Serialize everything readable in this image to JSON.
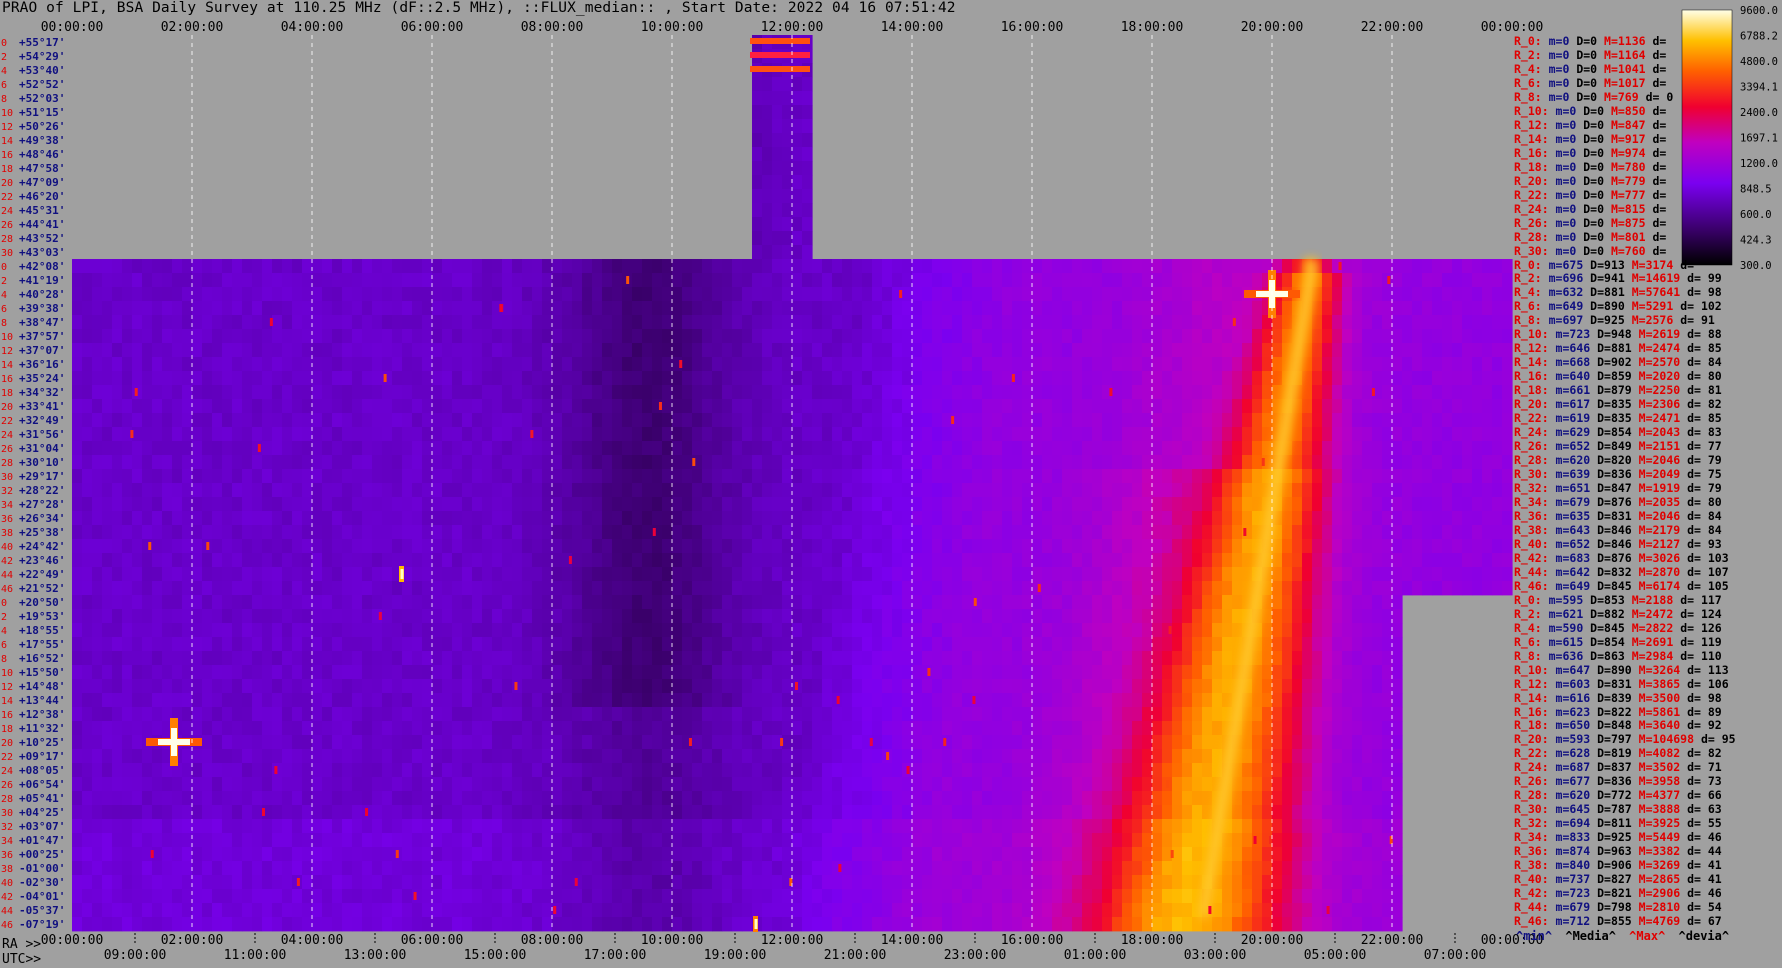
{
  "title": "PRAO of LPI, BSA Daily Survey at 110.25 MHz (dF::2.5 MHz), ::FLUX_median:: , Start Date: 2022 04 16 07:51:42",
  "top_time_labels": [
    "00:00:00",
    "02:00:00",
    "04:00:00",
    "06:00:00",
    "08:00:00",
    "10:00:00",
    "12:00:00",
    "14:00:00",
    "16:00:00",
    "18:00:00",
    "20:00:00",
    "22:00:00",
    "00:00:00"
  ],
  "ra_prefix": "RA >>",
  "ra_labels": [
    "00:00:00",
    "02:00:00",
    "04:00:00",
    "06:00:00",
    "08:00:00",
    "10:00:00",
    "12:00:00",
    "14:00:00",
    "16:00:00",
    "18:00:00",
    "20:00:00",
    "22:00:00",
    "00:00:00"
  ],
  "utc_prefix": "UTC>>",
  "utc_labels": [
    "09:00:00",
    "11:00:00",
    "13:00:00",
    "15:00:00",
    "17:00:00",
    "19:00:00",
    "21:00:00",
    "23:00:00",
    "01:00:00",
    "03:00:00",
    "05:00:00",
    "07:00:00"
  ],
  "colorbar_labels": [
    "9600.0",
    "6788.2",
    "4800.0",
    "3394.1",
    "2400.0",
    "1697.1",
    "1200.0",
    "848.5",
    "600.0",
    "424.3",
    "300.0"
  ],
  "declinations": [
    "+55°17'",
    "+54°29'",
    "+53°40'",
    "+52°52'",
    "+52°03'",
    "+51°15'",
    "+50°26'",
    "+49°38'",
    "+48°46'",
    "+47°58'",
    "+47°09'",
    "+46°20'",
    "+45°31'",
    "+44°41'",
    "+43°52'",
    "+43°03'",
    "+42°08'",
    "+41°19'",
    "+40°28'",
    "+39°38'",
    "+38°47'",
    "+37°57'",
    "+37°07'",
    "+36°16'",
    "+35°24'",
    "+34°32'",
    "+33°41'",
    "+32°49'",
    "+31°56'",
    "+31°04'",
    "+30°10'",
    "+29°17'",
    "+28°22'",
    "+27°28'",
    "+26°34'",
    "+25°38'",
    "+24°42'",
    "+23°46'",
    "+22°49'",
    "+21°52'",
    "+20°50'",
    "+19°53'",
    "+18°55'",
    "+17°55'",
    "+16°52'",
    "+15°50'",
    "+14°48'",
    "+13°44'",
    "+12°38'",
    "+11°32'",
    "+10°25'",
    "+09°17'",
    "+08°05'",
    "+06°54'",
    "+05°41'",
    "+04°25'",
    "+03°07'",
    "+01°47'",
    "+00°25'",
    "-01°00'",
    "-02°30'",
    "-04°01'",
    "-05°37'",
    "-07°19'"
  ],
  "row_index_labels": [
    "0",
    "2",
    "4",
    "6",
    "8",
    "10",
    "12",
    "14",
    "16",
    "18",
    "20",
    "22",
    "24",
    "26",
    "28",
    "30",
    "0",
    "2",
    "4",
    "6",
    "8",
    "10",
    "12",
    "14",
    "16",
    "18",
    "20",
    "22",
    "24",
    "26",
    "28",
    "30",
    "32",
    "34",
    "36",
    "38",
    "40",
    "42",
    "44",
    "46",
    "0",
    "2",
    "4",
    "6",
    "8",
    "10",
    "12",
    "14",
    "16",
    "18",
    "20",
    "22",
    "24",
    "26",
    "28",
    "30",
    "32",
    "34",
    "36",
    "38",
    "40",
    "42",
    "44",
    "46"
  ],
  "stats": [
    {
      "k": "R_0:",
      "m": "m=0",
      "d": "D=0",
      "mx": "M=1136",
      "dv": "d="
    },
    {
      "k": "R_2:",
      "m": "m=0",
      "d": "D=0",
      "mx": "M=1164",
      "dv": "d="
    },
    {
      "k": "R_4:",
      "m": "m=0",
      "d": "D=0",
      "mx": "M=1041",
      "dv": "d="
    },
    {
      "k": "R_6:",
      "m": "m=0",
      "d": "D=0",
      "mx": "M=1017",
      "dv": "d="
    },
    {
      "k": "R_8:",
      "m": "m=0",
      "d": "D=0",
      "mx": "M=769",
      "dv": "d= 0"
    },
    {
      "k": "R_10:",
      "m": "m=0",
      "d": "D=0",
      "mx": "M=850",
      "dv": "d="
    },
    {
      "k": "R_12:",
      "m": "m=0",
      "d": "D=0",
      "mx": "M=847",
      "dv": "d="
    },
    {
      "k": "R_14:",
      "m": "m=0",
      "d": "D=0",
      "mx": "M=917",
      "dv": "d="
    },
    {
      "k": "R_16:",
      "m": "m=0",
      "d": "D=0",
      "mx": "M=974",
      "dv": "d="
    },
    {
      "k": "R_18:",
      "m": "m=0",
      "d": "D=0",
      "mx": "M=780",
      "dv": "d="
    },
    {
      "k": "R_20:",
      "m": "m=0",
      "d": "D=0",
      "mx": "M=779",
      "dv": "d="
    },
    {
      "k": "R_22:",
      "m": "m=0",
      "d": "D=0",
      "mx": "M=777",
      "dv": "d="
    },
    {
      "k": "R_24:",
      "m": "m=0",
      "d": "D=0",
      "mx": "M=815",
      "dv": "d="
    },
    {
      "k": "R_26:",
      "m": "m=0",
      "d": "D=0",
      "mx": "M=875",
      "dv": "d="
    },
    {
      "k": "R_28:",
      "m": "m=0",
      "d": "D=0",
      "mx": "M=801",
      "dv": "d="
    },
    {
      "k": "R_30:",
      "m": "m=0",
      "d": "D=0",
      "mx": "M=760",
      "dv": "d="
    },
    {
      "k": "R_0:",
      "m": "m=675",
      "d": "D=913",
      "mx": "M=3174",
      "dv": "d="
    },
    {
      "k": "R_2:",
      "m": "m=696",
      "d": "D=941",
      "mx": "M=14619",
      "dv": "d= 99"
    },
    {
      "k": "R_4:",
      "m": "m=632",
      "d": "D=881",
      "mx": "M=57641",
      "dv": "d= 98"
    },
    {
      "k": "R_6:",
      "m": "m=649",
      "d": "D=890",
      "mx": "M=5291",
      "dv": "d= 102"
    },
    {
      "k": "R_8:",
      "m": "m=697",
      "d": "D=925",
      "mx": "M=2576",
      "dv": "d= 91"
    },
    {
      "k": "R_10:",
      "m": "m=723",
      "d": "D=948",
      "mx": "M=2619",
      "dv": "d= 88"
    },
    {
      "k": "R_12:",
      "m": "m=646",
      "d": "D=881",
      "mx": "M=2474",
      "dv": "d= 85"
    },
    {
      "k": "R_14:",
      "m": "m=668",
      "d": "D=902",
      "mx": "M=2570",
      "dv": "d= 84"
    },
    {
      "k": "R_16:",
      "m": "m=640",
      "d": "D=859",
      "mx": "M=2020",
      "dv": "d= 80"
    },
    {
      "k": "R_18:",
      "m": "m=661",
      "d": "D=879",
      "mx": "M=2250",
      "dv": "d= 81"
    },
    {
      "k": "R_20:",
      "m": "m=617",
      "d": "D=835",
      "mx": "M=2306",
      "dv": "d= 82"
    },
    {
      "k": "R_22:",
      "m": "m=619",
      "d": "D=835",
      "mx": "M=2471",
      "dv": "d= 85"
    },
    {
      "k": "R_24:",
      "m": "m=629",
      "d": "D=854",
      "mx": "M=2043",
      "dv": "d= 83"
    },
    {
      "k": "R_26:",
      "m": "m=652",
      "d": "D=849",
      "mx": "M=2151",
      "dv": "d= 77"
    },
    {
      "k": "R_28:",
      "m": "m=620",
      "d": "D=820",
      "mx": "M=2046",
      "dv": "d= 79"
    },
    {
      "k": "R_30:",
      "m": "m=639",
      "d": "D=836",
      "mx": "M=2049",
      "dv": "d= 75"
    },
    {
      "k": "R_32:",
      "m": "m=651",
      "d": "D=847",
      "mx": "M=1919",
      "dv": "d= 79"
    },
    {
      "k": "R_34:",
      "m": "m=679",
      "d": "D=876",
      "mx": "M=2035",
      "dv": "d= 80"
    },
    {
      "k": "R_36:",
      "m": "m=635",
      "d": "D=831",
      "mx": "M=2046",
      "dv": "d= 84"
    },
    {
      "k": "R_38:",
      "m": "m=643",
      "d": "D=846",
      "mx": "M=2179",
      "dv": "d= 84"
    },
    {
      "k": "R_40:",
      "m": "m=652",
      "d": "D=846",
      "mx": "M=2127",
      "dv": "d= 93"
    },
    {
      "k": "R_42:",
      "m": "m=683",
      "d": "D=876",
      "mx": "M=3026",
      "dv": "d= 103"
    },
    {
      "k": "R_44:",
      "m": "m=642",
      "d": "D=832",
      "mx": "M=2870",
      "dv": "d= 107"
    },
    {
      "k": "R_46:",
      "m": "m=649",
      "d": "D=845",
      "mx": "M=6174",
      "dv": "d= 105"
    },
    {
      "k": "R_0:",
      "m": "m=595",
      "d": "D=853",
      "mx": "M=2188",
      "dv": "d= 117"
    },
    {
      "k": "R_2:",
      "m": "m=621",
      "d": "D=882",
      "mx": "M=2472",
      "dv": "d= 124"
    },
    {
      "k": "R_4:",
      "m": "m=590",
      "d": "D=845",
      "mx": "M=2822",
      "dv": "d= 126"
    },
    {
      "k": "R_6:",
      "m": "m=615",
      "d": "D=854",
      "mx": "M=2691",
      "dv": "d= 119"
    },
    {
      "k": "R_8:",
      "m": "m=636",
      "d": "D=863",
      "mx": "M=2984",
      "dv": "d= 110"
    },
    {
      "k": "R_10:",
      "m": "m=647",
      "d": "D=890",
      "mx": "M=3264",
      "dv": "d= 113"
    },
    {
      "k": "R_12:",
      "m": "m=603",
      "d": "D=831",
      "mx": "M=3865",
      "dv": "d= 106"
    },
    {
      "k": "R_14:",
      "m": "m=616",
      "d": "D=839",
      "mx": "M=3500",
      "dv": "d= 98"
    },
    {
      "k": "R_16:",
      "m": "m=623",
      "d": "D=822",
      "mx": "M=5861",
      "dv": "d= 89"
    },
    {
      "k": "R_18:",
      "m": "m=650",
      "d": "D=848",
      "mx": "M=3640",
      "dv": "d= 92"
    },
    {
      "k": "R_20:",
      "m": "m=593",
      "d": "D=797",
      "mx": "M=104698",
      "dv": "d= 95"
    },
    {
      "k": "R_22:",
      "m": "m=628",
      "d": "D=819",
      "mx": "M=4082",
      "dv": "d= 82"
    },
    {
      "k": "R_24:",
      "m": "m=687",
      "d": "D=837",
      "mx": "M=3502",
      "dv": "d= 71"
    },
    {
      "k": "R_26:",
      "m": "m=677",
      "d": "D=836",
      "mx": "M=3958",
      "dv": "d= 73"
    },
    {
      "k": "R_28:",
      "m": "m=620",
      "d": "D=772",
      "mx": "M=4377",
      "dv": "d= 66"
    },
    {
      "k": "R_30:",
      "m": "m=645",
      "d": "D=787",
      "mx": "M=3888",
      "dv": "d= 63"
    },
    {
      "k": "R_32:",
      "m": "m=694",
      "d": "D=811",
      "mx": "M=3925",
      "dv": "d= 55"
    },
    {
      "k": "R_34:",
      "m": "m=833",
      "d": "D=925",
      "mx": "M=5449",
      "dv": "d= 46"
    },
    {
      "k": "R_36:",
      "m": "m=874",
      "d": "D=963",
      "mx": "M=3382",
      "dv": "d= 44"
    },
    {
      "k": "R_38:",
      "m": "m=840",
      "d": "D=906",
      "mx": "M=3269",
      "dv": "d= 41"
    },
    {
      "k": "R_40:",
      "m": "m=737",
      "d": "D=827",
      "mx": "M=2865",
      "dv": "d= 41"
    },
    {
      "k": "R_42:",
      "m": "m=723",
      "d": "D=821",
      "mx": "M=2906",
      "dv": "d= 46"
    },
    {
      "k": "R_44:",
      "m": "m=679",
      "d": "D=798",
      "mx": "M=2810",
      "dv": "d= 54"
    },
    {
      "k": "R_46:",
      "m": "m=712",
      "d": "D=855",
      "mx": "M=4769",
      "dv": "d= 67"
    }
  ],
  "footer_legend": {
    "min": "^min^",
    "median": "^Media^",
    "max": "^Max^",
    "dev": "^devia^"
  },
  "colors": {
    "background": "#a0a0a0",
    "no_data": "#a0a0a0",
    "label_red": "#e00000",
    "label_blue": "#101080"
  },
  "chart_data": {
    "type": "heatmap",
    "title": "PRAO of LPI, BSA Daily Survey at 110.25 MHz (dF::2.5 MHz), ::FLUX_median:: , Start Date: 2022 04 16 07:51:42",
    "x_axis": {
      "quantity": "time (sidereal / RA)",
      "range_hours": [
        0,
        24
      ],
      "tick_hours": [
        0,
        2,
        4,
        6,
        8,
        10,
        12,
        14,
        16,
        18,
        20,
        22,
        24
      ]
    },
    "y_axis": {
      "quantity": "declination",
      "count": 64
    },
    "color_scale": {
      "type": "log",
      "range": [
        300,
        9600
      ],
      "ticks": [
        9600.0,
        6788.2,
        4800.0,
        3394.1,
        2400.0,
        1697.1,
        1200.0,
        848.5,
        600.0,
        424.3,
        300.0
      ]
    },
    "no_data_regions": [
      {
        "rows": [
          0,
          15
        ],
        "hours": [
          0,
          11.3
        ]
      },
      {
        "rows": [
          0,
          15
        ],
        "hours": [
          12.3,
          24
        ]
      },
      {
        "rows": [
          40,
          63
        ],
        "hours": [
          22.2,
          24
        ]
      }
    ],
    "galactic_ridge": {
      "hours_at_top_row": [
        20.6
      ],
      "hours_at_bottom_row": [
        18.8
      ]
    },
    "sources": [
      {
        "name": "",
        "hour": 1.7,
        "row": 50,
        "peak": 104698
      },
      {
        "name": "",
        "hour": 20.0,
        "row": 18,
        "peak": 57641
      },
      {
        "name": "",
        "hour": 5.5,
        "row": 38,
        "peak": 6174
      },
      {
        "name": "",
        "hour": 11.4,
        "row": 63,
        "peak": 4769
      }
    ]
  }
}
